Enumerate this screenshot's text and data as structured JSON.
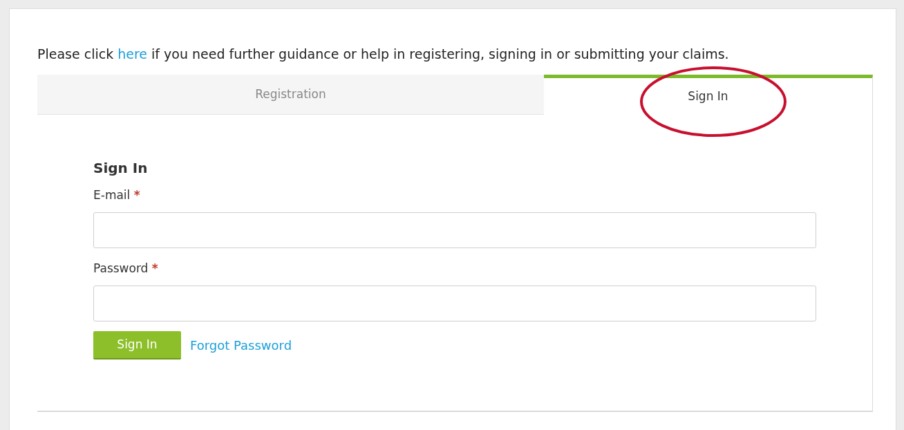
{
  "intro": {
    "before": "Please click ",
    "link": "here",
    "after": " if you need further guidance or help in registering, signing in or submitting your claims."
  },
  "tabs": [
    {
      "label": "Registration",
      "selected": false
    },
    {
      "label": "Sign In",
      "selected": true
    }
  ],
  "form": {
    "title": "Sign In",
    "fields": [
      {
        "label": "E-mail",
        "required_mark": "*"
      },
      {
        "label": "Password",
        "required_mark": "*"
      }
    ],
    "submit": "Sign In",
    "link": "Forgot Password"
  }
}
